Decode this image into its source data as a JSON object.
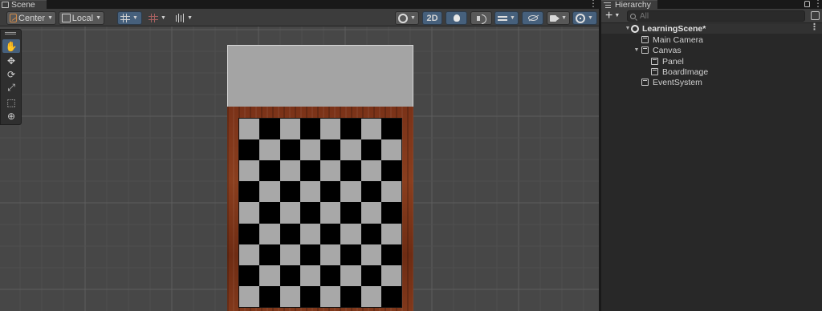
{
  "scene": {
    "tab_label": "Scene",
    "toolbar": {
      "pivot_label": "Center",
      "space_label": "Local",
      "mode_2d_label": "2D"
    }
  },
  "hierarchy": {
    "tab_label": "Hierarchy",
    "search_placeholder": "All",
    "scene_name": "LearningScene*",
    "items": [
      {
        "label": "Main Camera"
      },
      {
        "label": "Canvas"
      },
      {
        "label": "Panel"
      },
      {
        "label": "BoardImage"
      },
      {
        "label": "EventSystem"
      }
    ]
  },
  "colors": {
    "light_square": "#a8a8a8",
    "dark_square": "#000000",
    "active_blue": "#46607c",
    "board_wood": "#7a3218"
  }
}
